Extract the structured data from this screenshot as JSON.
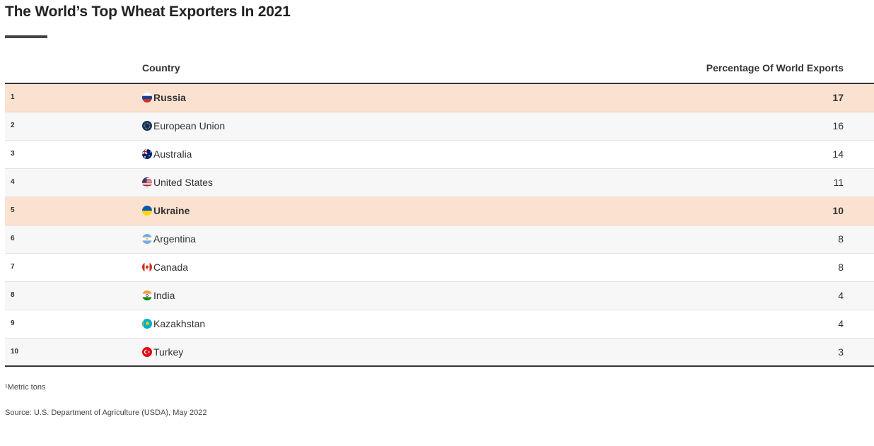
{
  "title": "The World’s Top Wheat Exporters In 2021",
  "chart_data": {
    "type": "table",
    "columns": [
      "",
      "Country",
      "Percentage Of World Exports"
    ],
    "highlight_color": "#fbe1cf",
    "rows": [
      {
        "rank": "1",
        "country": "Russia",
        "flag": "russia-flag-icon",
        "value": 17,
        "highlight": true
      },
      {
        "rank": "2",
        "country": "European Union",
        "flag": "eu-flag-icon",
        "value": 16,
        "highlight": false
      },
      {
        "rank": "3",
        "country": "Australia",
        "flag": "australia-flag-icon",
        "value": 14,
        "highlight": false
      },
      {
        "rank": "4",
        "country": "United States",
        "flag": "usa-flag-icon",
        "value": 11,
        "highlight": false
      },
      {
        "rank": "5",
        "country": "Ukraine",
        "flag": "ukraine-flag-icon",
        "value": 10,
        "highlight": true
      },
      {
        "rank": "6",
        "country": "Argentina",
        "flag": "argentina-flag-icon",
        "value": 8,
        "highlight": false
      },
      {
        "rank": "7",
        "country": "Canada",
        "flag": "canada-flag-icon",
        "value": 8,
        "highlight": false
      },
      {
        "rank": "8",
        "country": "India",
        "flag": "india-flag-icon",
        "value": 4,
        "highlight": false
      },
      {
        "rank": "9",
        "country": "Kazakhstan",
        "flag": "kazakhstan-flag-icon",
        "value": 4,
        "highlight": false
      },
      {
        "rank": "10",
        "country": "Turkey",
        "flag": "turkey-flag-icon",
        "value": 3,
        "highlight": false
      }
    ]
  },
  "footnote": "¹Metric tons",
  "source": "Source: U.S. Department of Agriculture (USDA), May 2022"
}
